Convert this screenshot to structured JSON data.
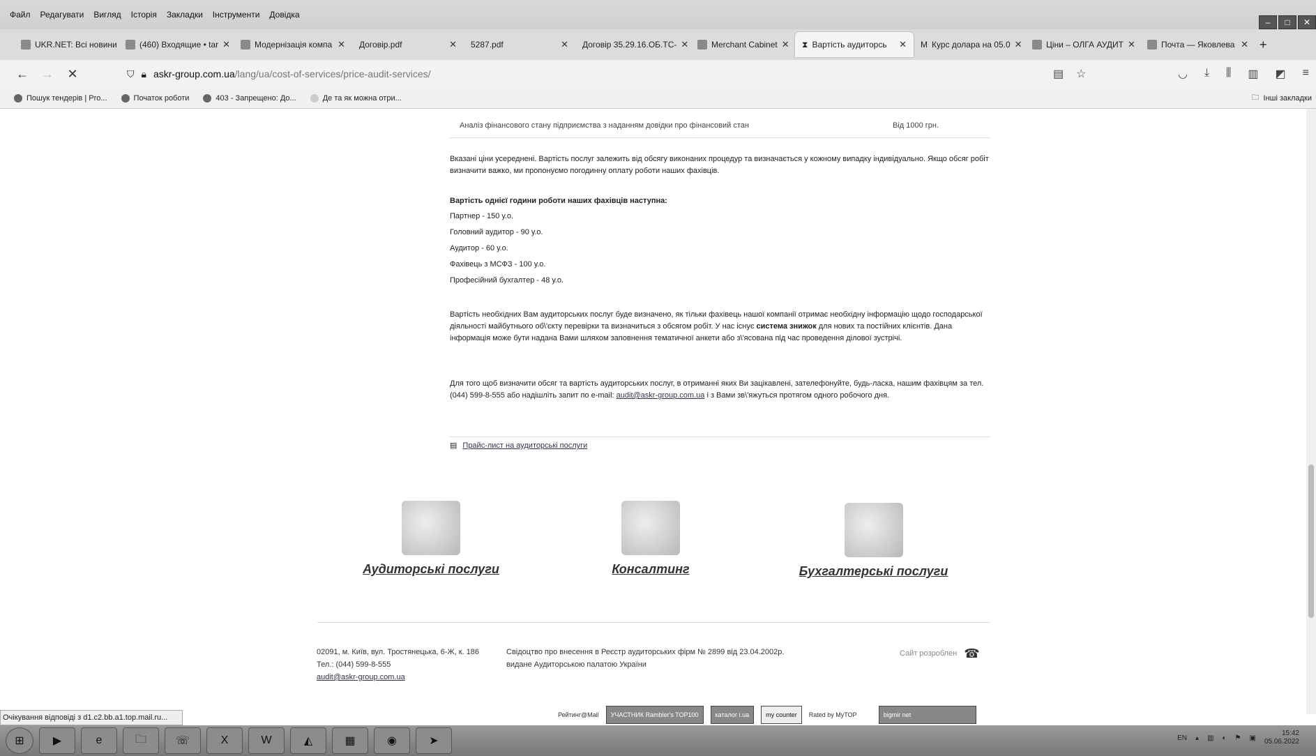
{
  "menubar": {
    "items": [
      "Файл",
      "Редагувати",
      "Вигляд",
      "Історія",
      "Закладки",
      "Інструменти",
      "Довідка"
    ]
  },
  "tabs": [
    {
      "label": "UKR.NET: Всі новини",
      "icon": "ukrnet-icon"
    },
    {
      "label": "(460) Входящие • tar",
      "icon": "mail-icon"
    },
    {
      "label": "Модернізація компа",
      "icon": "eye-icon"
    },
    {
      "label": "Договір.pdf",
      "icon": "pdf-icon"
    },
    {
      "label": "5287.pdf",
      "icon": "pdf-icon"
    },
    {
      "label": "Договір 35.29.16.ОБ.ТС-",
      "icon": "pdf-icon"
    },
    {
      "label": "Merchant Cabinet",
      "icon": "merchant-icon"
    },
    {
      "label": "Вартість аудиторсь",
      "icon": "loading-icon",
      "active": true
    },
    {
      "label": "Курс долара на 05.0",
      "icon": "minfin-icon"
    },
    {
      "label": "Ціни – ОЛГА АУДИТ",
      "icon": "olga-icon"
    },
    {
      "label": "Почта — Яковлева",
      "icon": "outlook-icon"
    }
  ],
  "navbar": {
    "host": "askr-group.com.ua",
    "path": "/lang/ua/cost-of-services/price-audit-services/"
  },
  "bookmarks": [
    "Пошук тендерів | Pro...",
    "Початок роботи",
    "403 - Запрещено: До...",
    "Де та як можна отри..."
  ],
  "bookmarks_other": "Інші закладки",
  "table_row": {
    "service": "Аналіз фінансового стану підприємства з наданням довідки про фінансовий стан",
    "price": "Від 1000 грн."
  },
  "para1": "Вказані ціни усереднені. Вартість послуг залежить від обсягу виконаних процедур та визначається у кожному випадку індивідуально. Якщо обсяг робіт визначити важко, ми пропонуємо погодинну оплату роботи наших фахівців.",
  "rates_title": "Вартість однієї години роботи наших фахівців наступна:",
  "rates": [
    "Партнер - 150 у.о.",
    "Головний аудитор - 90 у.о.",
    "Аудитор - 60 у.о.",
    "Фахівець з МСФЗ - 100 у.о.",
    "Професійний бухгалтер - 48 у.о."
  ],
  "para2_a": "Вартість необхідних Вам аудиторських послуг буде визначено, як тільки фахівець нашої компанії отримає необхідну інформацію щодо господарської діяльності майбутнього об\\'єкту перевірки та визначиться з обсягом робіт. У нас існує ",
  "para2_bold": "система знижок",
  "para2_b": " для нових та постійних клієнтів. Дана інформація може бути надана Вами шляхом заповнення тематичної анкети або з\\'ясована під час проведення ділової зустрічі.",
  "para3_a": "Для того щоб визначити обсяг та вартість аудиторських послуг, в отриманні яких Ви зацікавлені, зателефонуйте, будь-ласка, нашим фахівцям за тел. (044) 599-8-555 або надішліть запит по e-mail: ",
  "para3_link": "audit@askr-group.com.ua",
  "para3_b": " і з Вами зв\\'яжуться протягом одного робочого дня.",
  "price_list_link": "Прайс-лист на аудиторські послуги",
  "services": [
    "Аудиторські послуги",
    "Консалтинг",
    "Бухгалтерські послуги"
  ],
  "footer": {
    "address": "02091, м. Київ, вул. Тростянецька, 6-Ж, к. 186",
    "phone": "Тел.: (044) 599-8-555",
    "email": "audit@askr-group.com.ua",
    "cert1": "Свідоцтво про внесення в Реєстр аудиторських фірм № 2899 від 23.04.2002р.",
    "cert2": "видане Аудиторською палатою України",
    "dev": "Сайт розроблен"
  },
  "badges": [
    "Рейтинг@Mail",
    "УЧАСТНИК Rambler's TOP100",
    "каталог i.ua",
    "my counter",
    "Rated by MyTOP",
    "bigmir net"
  ],
  "status": "Очікування відповіді з d1.c2.bb.a1.top.mail.ru...",
  "tray": {
    "lang": "EN",
    "time": "15:42",
    "date": "05.06.2022"
  }
}
